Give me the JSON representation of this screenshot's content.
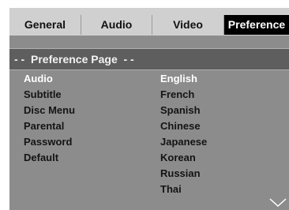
{
  "tabs": [
    {
      "label": "General"
    },
    {
      "label": "Audio"
    },
    {
      "label": "Video"
    },
    {
      "label": "Preference"
    }
  ],
  "active_tab": "Preference",
  "page_header": "- -  Preference Page  - -",
  "menu": {
    "items": [
      "Audio",
      "Subtitle",
      "Disc Menu",
      "Parental",
      "Password",
      "Default"
    ],
    "selected": "Audio"
  },
  "options": {
    "items": [
      "English",
      "French",
      "Spanish",
      "Chinese",
      "Japanese",
      "Korean",
      "Russian",
      "Thai"
    ],
    "selected": "English"
  },
  "icons": {
    "scroll": "chevron-down-icon"
  },
  "colors": {
    "panel": "#8c8c8c",
    "tab_bar": "#d0d0d0",
    "active_tab": "#000000",
    "header_bar": "#5e5e5e",
    "highlight_text": "#ffffff"
  }
}
